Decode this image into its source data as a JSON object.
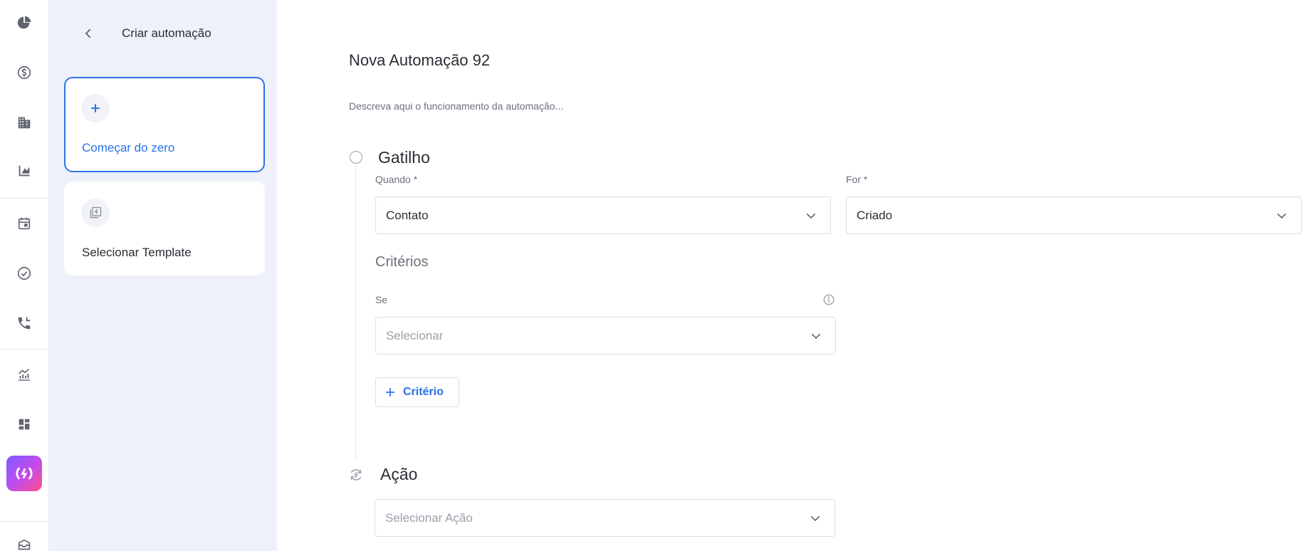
{
  "rail": {
    "icons": [
      "pie-chart-icon",
      "dollar-icon",
      "building-icon",
      "chart-ruler-icon",
      "calendar-icon",
      "check-circle-icon",
      "phone-icon",
      "trending-chart-icon",
      "dashboard-icon",
      "automation-icon",
      "inbox-icon"
    ],
    "active_gradient": [
      "#7b5cff",
      "#c04cf0",
      "#ff4f8b"
    ]
  },
  "panel": {
    "title": "Criar automação",
    "cards": [
      {
        "label": "Começar do zero",
        "icon": "plus-icon",
        "selected": true
      },
      {
        "label": "Selecionar Template",
        "icon": "template-icon",
        "selected": false
      }
    ]
  },
  "main": {
    "title": "Nova Automação 92",
    "description_placeholder": "Descreva aqui o funcionamento da automação...",
    "trigger": {
      "title": "Gatilho",
      "when_label": "Quando *",
      "when_value": "Contato",
      "for_label": "For *",
      "for_value": "Criado",
      "criteria_title": "Critérios",
      "if_label": "Se",
      "if_placeholder": "Selecionar",
      "add_criteria_label": "Critério"
    },
    "action": {
      "title": "Ação",
      "placeholder": "Selecionar Ação"
    }
  },
  "colors": {
    "accent": "#2a72e8",
    "panel_bg": "#eef1fa"
  }
}
